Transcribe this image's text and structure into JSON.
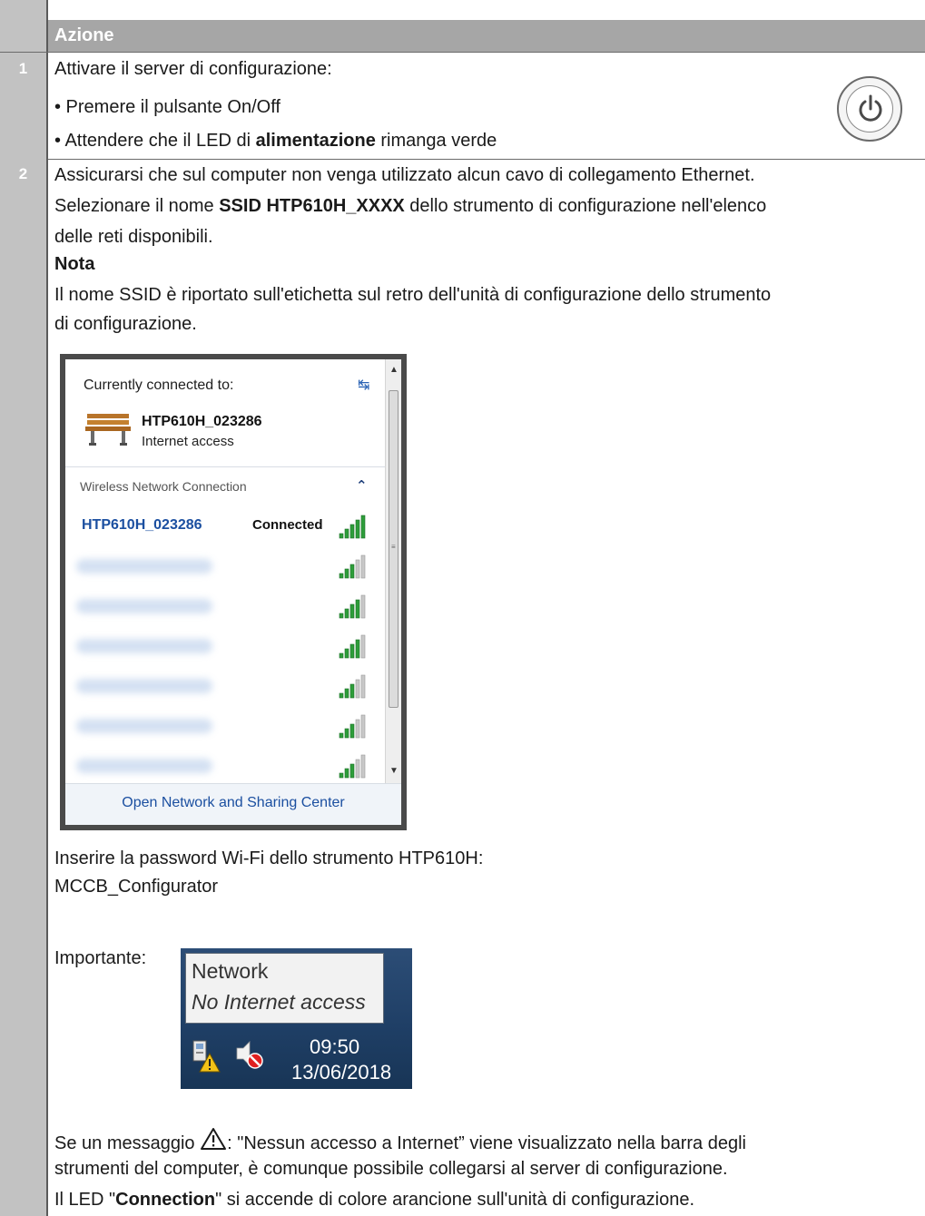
{
  "table": {
    "header": "Azione",
    "rows": [
      {
        "number": "1",
        "lines": [
          "Attivare il server di configurazione:",
          "• Premere il pulsante On/Off",
          "• Attendere che il LED di ",
          "alimentazione",
          " rimanga verde"
        ]
      },
      {
        "number": "2",
        "para1_line1": "Assicurarsi che sul computer non venga utilizzato alcun cavo di collegamento Ethernet.",
        "para1_line2_a": "Selezionare il nome ",
        "para1_line2_b": "SSID HTP610H_XXXX",
        "para1_line2_c": " dello strumento di configurazione nell'elenco",
        "para1_line3": "delle reti disponibili.",
        "note_title": "Nota",
        "note_line1": "Il nome SSID è riportato sull'etichetta sul retro dell'unità di configurazione dello strumento",
        "note_line2": "di configurazione.",
        "password_line1": "Inserire la password Wi-Fi dello strumento HTP610H:",
        "password_line2": "MCCB_Configurator",
        "important_label": "Importante:",
        "msg_line1_a": "Se un messaggio ",
        "msg_line1_b": ": \"Nessun accesso a Internet” viene visualizzato nella barra degli",
        "msg_line2": "strumenti del computer, è comunque possibile collegarsi al server di configurazione.",
        "led_a": "Il LED \"",
        "led_b": "Connection",
        "led_c": "\" si accende di colore arancione sull'unità di configurazione."
      }
    ]
  },
  "network_popup": {
    "currently_connected_label": "Currently connected to:",
    "current_ssid": "HTP610H_023286",
    "current_access": "Internet access",
    "section_label": "Wireless Network Connection",
    "networks": [
      {
        "name": "HTP610H_023286",
        "status": "Connected",
        "bars": 5
      },
      {
        "name": "",
        "status": "",
        "bars": 3
      },
      {
        "name": "",
        "status": "",
        "bars": 4
      },
      {
        "name": "",
        "status": "",
        "bars": 4
      },
      {
        "name": "",
        "status": "",
        "bars": 3
      },
      {
        "name": "",
        "status": "",
        "bars": 3
      },
      {
        "name": "",
        "status": "",
        "bars": 3
      }
    ],
    "footer_link": "Open Network and Sharing Center"
  },
  "taskbar": {
    "tooltip_title": "Network",
    "tooltip_status": "No Internet access",
    "time": "09:50",
    "date": "13/06/2018"
  },
  "colors": {
    "number_column": "#c2c2c2",
    "header_bg": "#a6a6a6",
    "link_blue": "#1b4fa0",
    "signal_green": "#2e9d3a",
    "taskbar_blue": "#1f3f66"
  },
  "icons": [
    "power-button-icon",
    "sync-icon",
    "bench-network-icon",
    "chevron-up-icon",
    "signal-bars-icon",
    "network-warning-icon",
    "speaker-muted-icon",
    "warning-triangle-icon"
  ]
}
